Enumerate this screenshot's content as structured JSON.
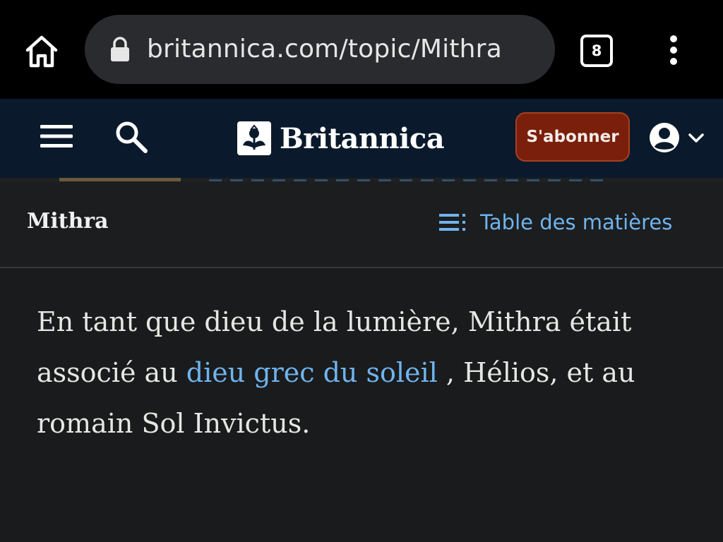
{
  "browser": {
    "url": "britannica.com/topic/Mithra",
    "tab_count": "8",
    "icons": [
      "home-icon",
      "lock-icon",
      "tab-switcher-icon",
      "more-vert-icon"
    ]
  },
  "header": {
    "logo_text": "Britannica",
    "subscribe_label": "S'abonner",
    "icons": [
      "hamburger-icon",
      "search-icon",
      "account-icon",
      "chevron-down-icon"
    ],
    "colors": {
      "background": "#0a1a2c",
      "subscribe": "#7a1f0b"
    }
  },
  "article": {
    "title": "Mithra",
    "toc_label": "Table des matières",
    "paragraph": {
      "before": "En tant que dieu de la lumière, Mithra était associé au ",
      "link": "dieu grec du soleil",
      "after": " , Hélios, et au romain Sol Invictus."
    },
    "colors": {
      "link": "#6fb4ee",
      "text": "#e6e6e2"
    }
  }
}
